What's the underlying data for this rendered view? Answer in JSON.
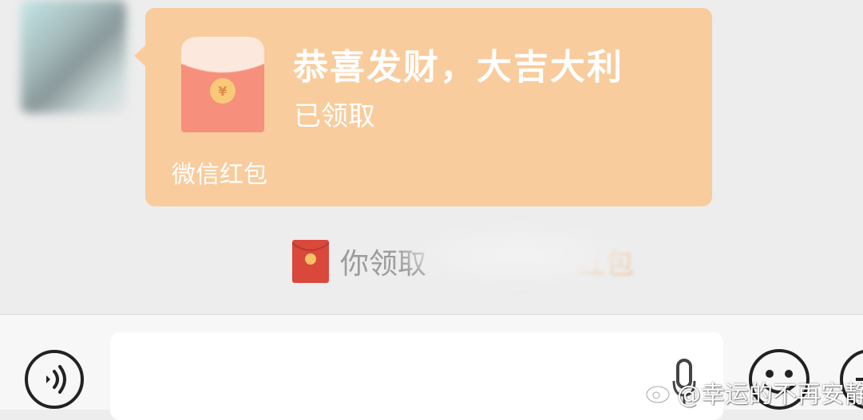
{
  "red_packet": {
    "title": "恭喜发财，大吉大利",
    "status": "已领取",
    "footer": "微信红包",
    "currency_symbol": "¥",
    "bubble_color": "#f9cc9d"
  },
  "system_notice": {
    "text_prefix": "你领取",
    "text_suffix": "红包",
    "icon": "red-packet-icon",
    "link_color": "#f0a45b"
  },
  "input_bar": {
    "voice_icon": "voice-icon",
    "placeholder": "",
    "mic_icon": "microphone-icon",
    "emoji_icon": "emoji-icon",
    "plus_icon": "plus-icon"
  },
  "watermark": {
    "text": "@幸运的不再安静",
    "logo": "weibo-logo-icon"
  }
}
